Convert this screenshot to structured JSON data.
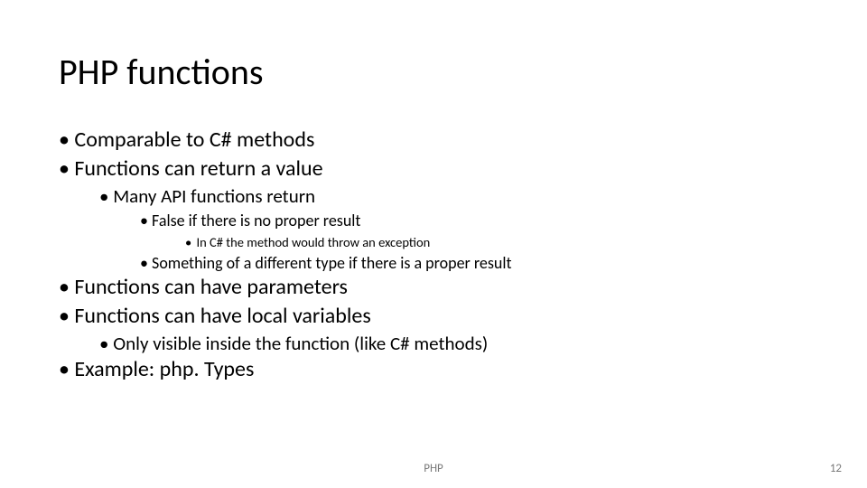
{
  "title": "PHP functions",
  "bullets": {
    "b1": "Comparable to C# methods",
    "b2": "Functions can return a value",
    "b2a": "Many API functions return",
    "b2a1": "False if there is no proper result",
    "b2a1i": "In C# the method would throw an exception",
    "b2a2": "Something of a different type if there is a proper result",
    "b3": "Functions can have parameters",
    "b4": "Functions can have local variables",
    "b4a": "Only visible inside the function (like C# methods)",
    "b5": "Example: php. Types"
  },
  "footer": "PHP",
  "page_number": "12"
}
